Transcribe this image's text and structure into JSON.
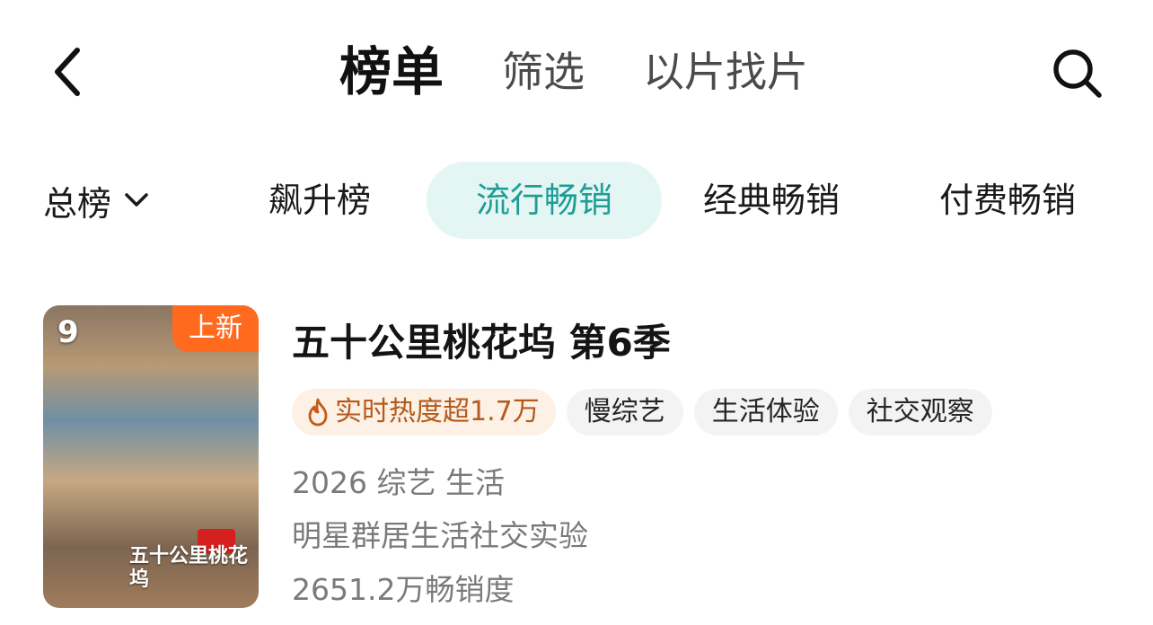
{
  "nav": {
    "tabs": [
      {
        "label": "榜单"
      },
      {
        "label": "筛选"
      },
      {
        "label": "以片找片"
      }
    ]
  },
  "categories": {
    "all_label": "总榜",
    "items": [
      {
        "label": "飙升榜"
      },
      {
        "label": "流行畅销"
      },
      {
        "label": "经典畅销"
      },
      {
        "label": "付费畅销"
      }
    ]
  },
  "list": {
    "items": [
      {
        "rank": "9",
        "badge": "上新",
        "poster_logo": "五十公里桃花坞",
        "title": "五十公里桃花坞 第6季",
        "heat": "实时热度超1.7万",
        "tags": [
          "慢综艺",
          "生活体验",
          "社交观察"
        ],
        "meta_line": "2026 综艺 生活",
        "description": "明星群居生活社交实验",
        "sales": "2651.2万畅销度"
      }
    ]
  },
  "colors": {
    "accent": "#1f9d95",
    "accent_bg": "#e4f6f4",
    "badge": "#ff6a1f",
    "heat_text": "#b45a1d",
    "heat_bg": "#fdf0e4"
  },
  "icons": {
    "back": "chevron-left-icon",
    "search": "search-icon",
    "dropdown": "chevron-down-icon",
    "heat": "flame-icon"
  }
}
